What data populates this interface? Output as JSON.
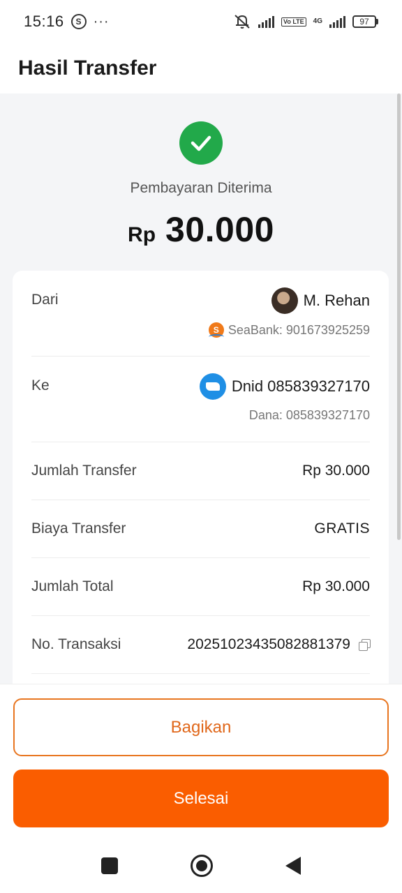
{
  "status_bar": {
    "time": "15:16",
    "more": "···",
    "volte": "Vo LTE",
    "network": "4G",
    "battery": "97"
  },
  "header": {
    "title": "Hasil Transfer"
  },
  "result": {
    "status": "Pembayaran Diterima",
    "currency": "Rp",
    "amount": "30.000",
    "accent_color": "#22a94a"
  },
  "details": {
    "from": {
      "label": "Dari",
      "name": "M. Rehan",
      "account": "SeaBank: 901673925259"
    },
    "to": {
      "label": "Ke",
      "name": "Dnid 085839327170",
      "account": "Dana: 085839327170"
    },
    "rows": [
      {
        "label": "Jumlah Transfer",
        "value": "Rp 30.000"
      },
      {
        "label": "Biaya Transfer",
        "value": "GRATIS"
      },
      {
        "label": "Jumlah Total",
        "value": "Rp 30.000"
      },
      {
        "label": "No. Transaksi",
        "value": "20251023435082881379"
      }
    ]
  },
  "actions": {
    "share_label": "Bagikan",
    "done_label": "Selesai",
    "brand_color": "#fa5d00"
  }
}
